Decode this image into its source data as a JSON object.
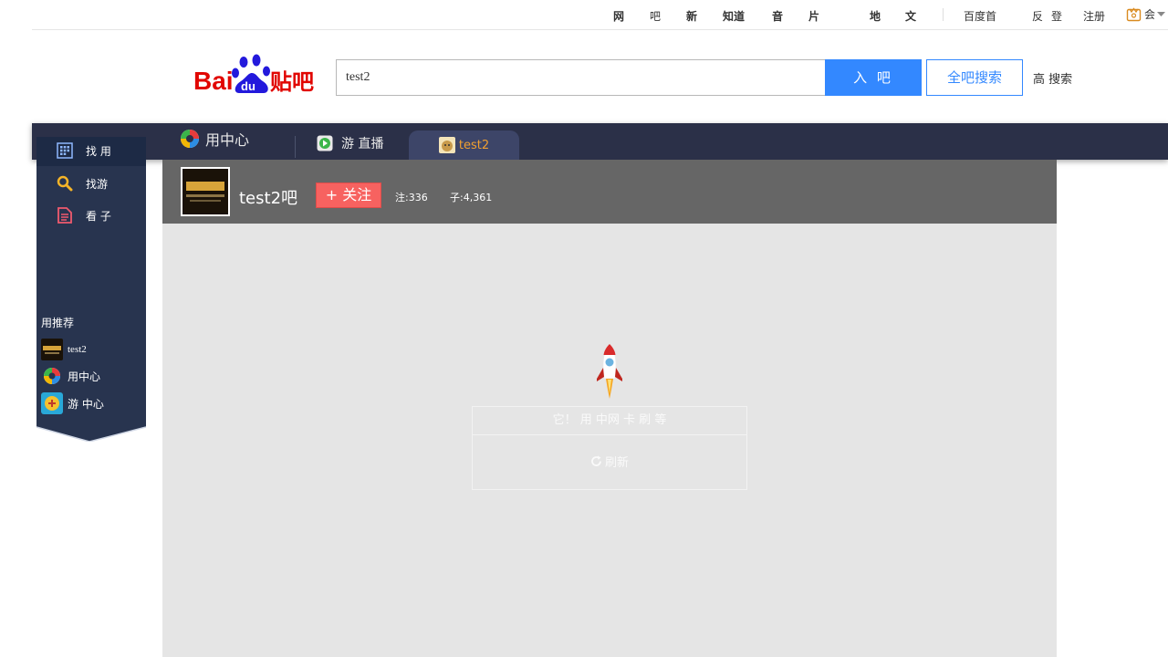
{
  "topnav": {
    "links": [
      "网",
      "吧",
      "新",
      "知道",
      "音",
      "片",
      "地",
      "文"
    ],
    "home": "百度首",
    "feedback": "反",
    "login": "登",
    "register": "注册",
    "member": "会"
  },
  "logo": {
    "text": "Baidu贴吧"
  },
  "search": {
    "value": "test2",
    "enter_label": "入 吧",
    "all_label": "全吧搜索",
    "advanced_label": "高 搜索"
  },
  "tabs": {
    "user_center": "用中心",
    "game_live": "游 直播",
    "forum": "test2"
  },
  "sidebar": {
    "nav": [
      {
        "label": "找 用",
        "icon": "grid-icon"
      },
      {
        "label": "找游",
        "icon": "search-icon"
      },
      {
        "label": "看 子",
        "icon": "document-icon"
      }
    ],
    "recommend_title": "用推荐",
    "recommend": [
      {
        "label": "test2"
      },
      {
        "label": "用中心"
      },
      {
        "label": "游 中心"
      }
    ]
  },
  "forum": {
    "name": "test2吧",
    "follow_label": "+ 关注",
    "followers": "注:336",
    "posts": "子:4,361"
  },
  "main": {
    "message": "它！ 用 中网 卡 刷 等",
    "refresh_label": "刷新"
  },
  "colors": {
    "accent": "#3388ff",
    "dark_bar": "#2b3048",
    "sidebar": "#28344f",
    "follow": "#f76260",
    "forum_head": "#666666",
    "content_bg": "#e5e5e5"
  }
}
